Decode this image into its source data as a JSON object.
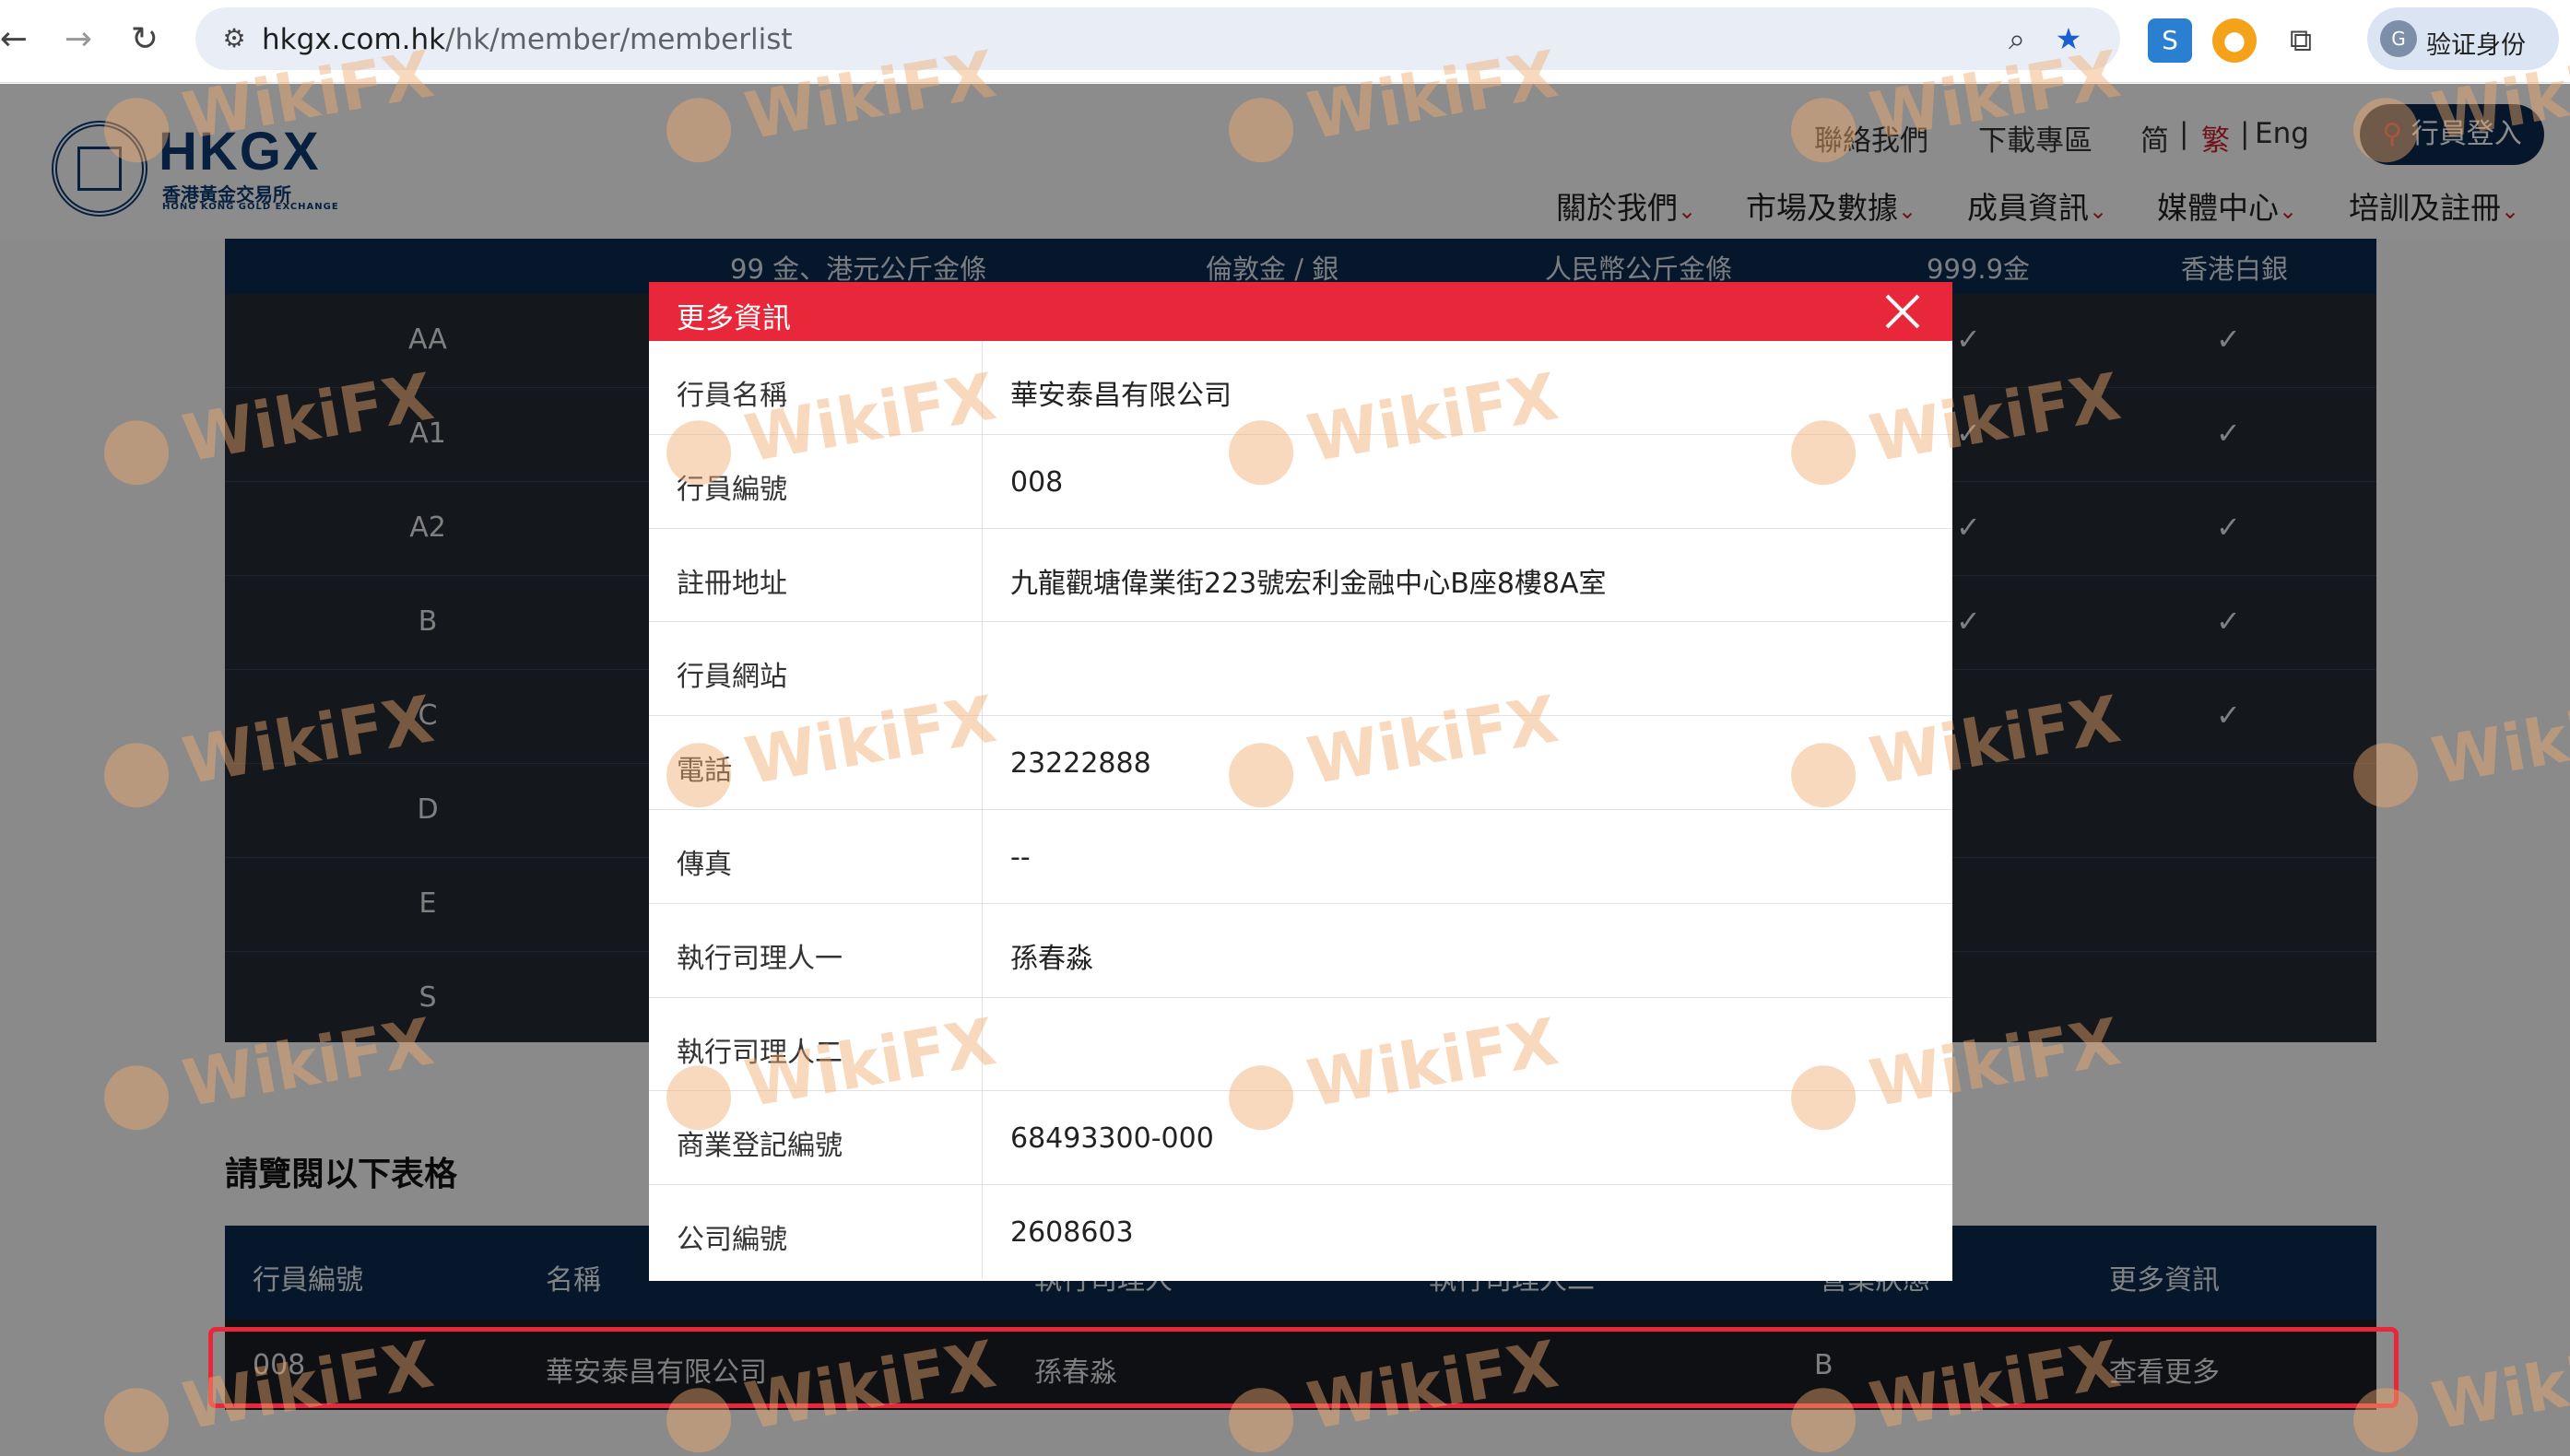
{
  "browser": {
    "url_host": "hkgx.com.hk",
    "url_path": "/hk/member/memberlist",
    "profile_label": "验证身份"
  },
  "header": {
    "logo_text": "HKGX",
    "logo_sub_cn": "香港黃金交易所",
    "logo_sub_en": "HONG KONG GOLD EXCHANGE",
    "top_links": [
      "聯絡我們",
      "下載專區"
    ],
    "lang_simplified": "简",
    "lang_traditional": "繁",
    "lang_english": "Eng",
    "lang_sep": "|",
    "login_label": "行員登入",
    "nav": [
      "關於我們",
      "市場及數據",
      "成員資訊",
      "媒體中心",
      "培訓及註冊"
    ]
  },
  "grade_table": {
    "headers": [
      "99 金、港元公斤金條",
      "倫敦金 / 銀",
      "人民幣公斤金條",
      "999.9金",
      "香港白銀"
    ],
    "rows": [
      "AA",
      "A1",
      "A2",
      "B",
      "C",
      "D",
      "E",
      "S"
    ],
    "check": "✓"
  },
  "section_title": "請覽閱以下表格",
  "member_table": {
    "headers": [
      "行員編號",
      "名稱",
      "執行司理人",
      "執行司理人二",
      "營業狀態",
      "更多資訊"
    ],
    "row": {
      "id": "008",
      "name": "華安泰昌有限公司",
      "manager": "孫春淼",
      "manager2": "",
      "grade": "B",
      "more": "查看更多"
    }
  },
  "modal": {
    "title": "更多資訊",
    "fields": [
      {
        "label": "行員名稱",
        "value": "華安泰昌有限公司"
      },
      {
        "label": "行員編號",
        "value": "008"
      },
      {
        "label": "註冊地址",
        "value": "九龍觀塘偉業街223號宏利金融中心B座8樓8A室"
      },
      {
        "label": "行員網站",
        "value": ""
      },
      {
        "label": "電話",
        "value": "23222888"
      },
      {
        "label": "傳真",
        "value": "--"
      },
      {
        "label": "執行司理人一",
        "value": "孫春淼"
      },
      {
        "label": "執行司理人二",
        "value": ""
      },
      {
        "label": "商業登記編號",
        "value": "68493300-000"
      },
      {
        "label": "公司編號",
        "value": "2608603"
      }
    ]
  },
  "watermark": "WikiFX",
  "colors": {
    "accent_red": "#e8283a",
    "navy": "#0d2a4f",
    "table_dark": "#262a33"
  }
}
